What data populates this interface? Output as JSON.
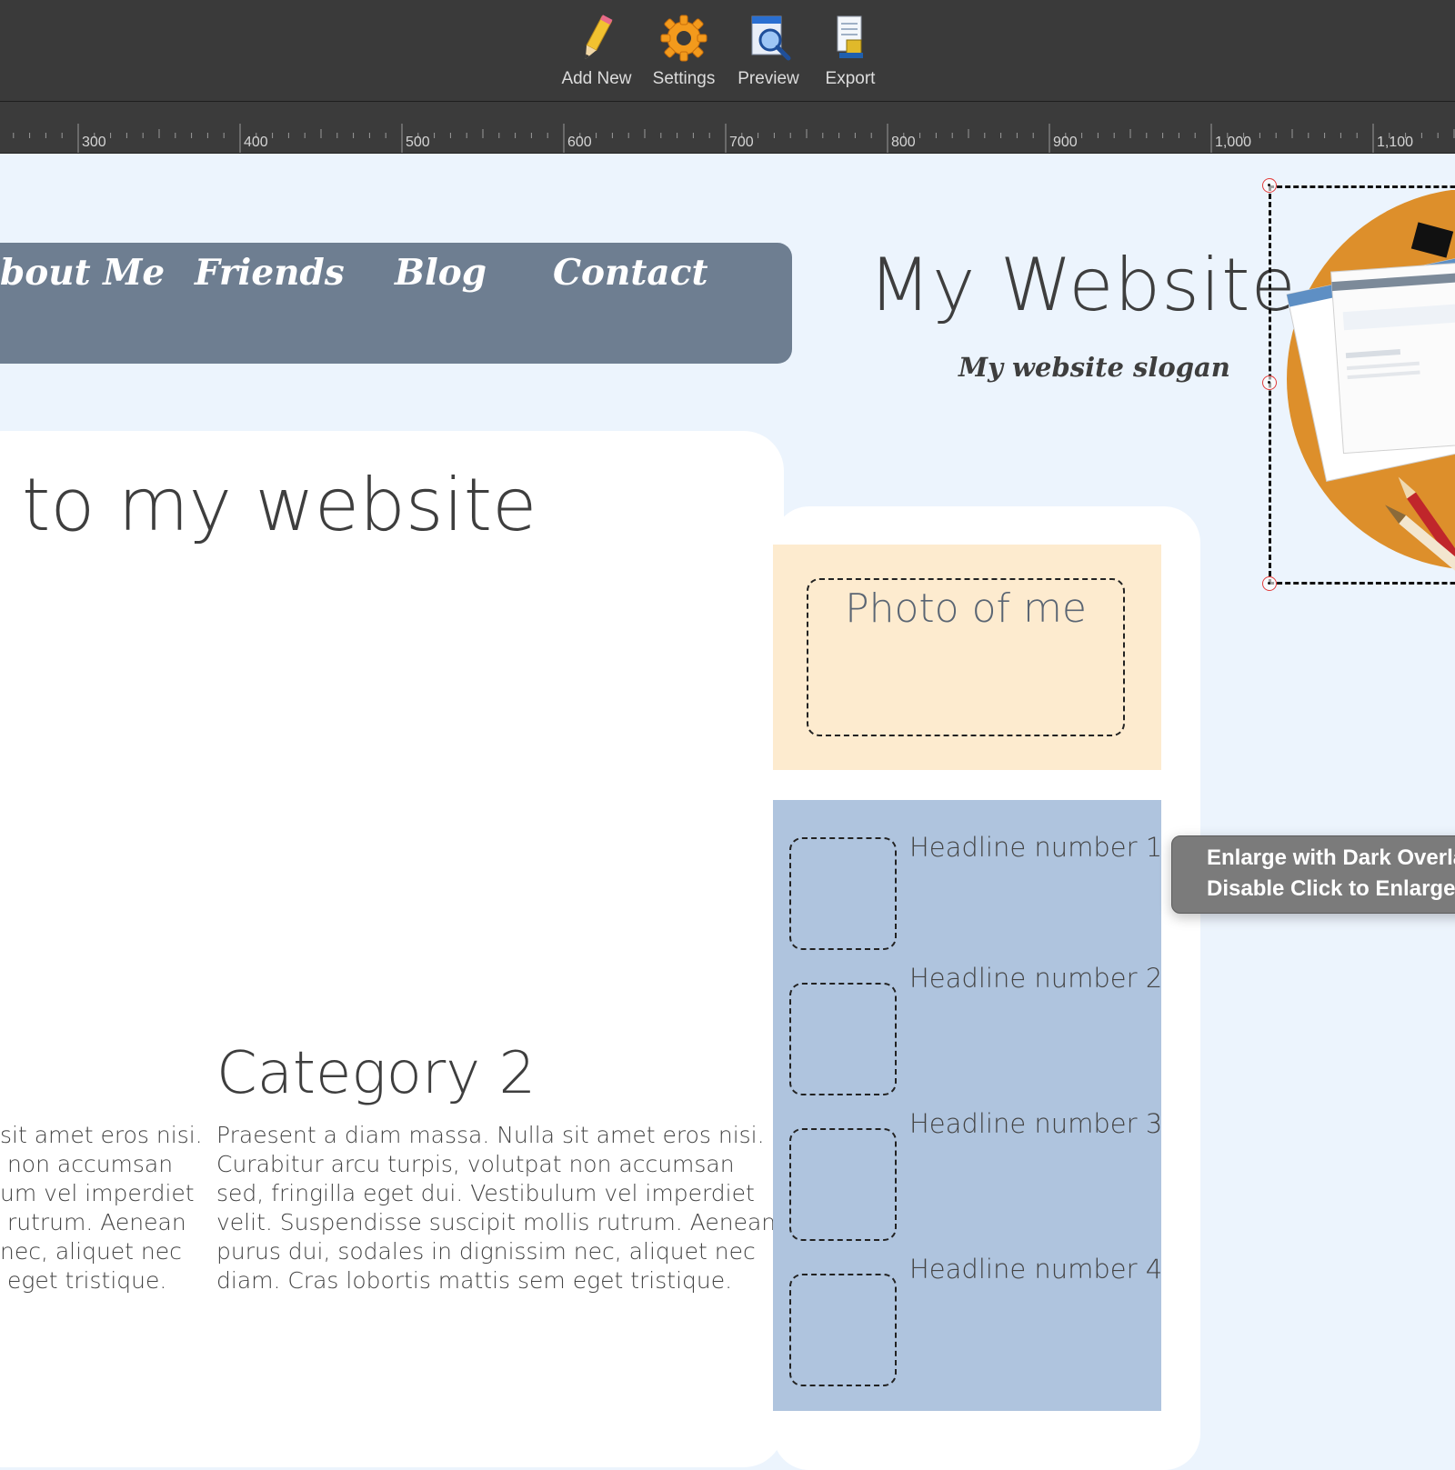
{
  "toolbar": {
    "add_new": "Add New",
    "settings": "Settings",
    "preview": "Preview",
    "export": "Export"
  },
  "ruler": {
    "labels": [
      "300",
      "400",
      "500",
      "600",
      "700",
      "800",
      "900",
      "1,000",
      "1,100"
    ]
  },
  "nav": {
    "about": "bout Me",
    "friends": "Friends",
    "blog": "Blog",
    "contact": "Contact"
  },
  "header": {
    "title": "My Website",
    "slogan": "My website slogan"
  },
  "main": {
    "welcome": "to my website",
    "category1_text": "sit amet eros nisi.\n non accumsan\num vel imperdiet\n rutrum. Aenean\nnec, aliquet nec\n eget tristique.",
    "category2_title": "Category 2",
    "category2_text": "Praesent a diam massa. Nulla sit amet eros nisi.\nCurabitur arcu turpis, volutpat non accumsan\nsed, fringilla eget dui. Vestibulum vel imperdiet\nvelit. Suspendisse suscipit mollis rutrum. Aenean\npurus dui, sodales in dignissim nec, aliquet nec\ndiam. Cras lobortis mattis sem eget tristique."
  },
  "sidebar": {
    "photo_label": "Photo of me",
    "headlines": [
      "Headline number 1",
      "Headline number 2",
      "Headline number 3",
      "Headline number 4"
    ]
  },
  "popup": {
    "item1": "Enlarge with Dark Overla",
    "item2": "Disable Click to Enlarge"
  },
  "colors": {
    "toolbar_bg": "#3a3a3a",
    "canvas_bg": "#ecf4fd",
    "nav_bg": "#6e7e91",
    "photo_bg": "#fdebcf",
    "headline_bg": "#afc4de",
    "popup_bg": "#7b7b7b"
  }
}
